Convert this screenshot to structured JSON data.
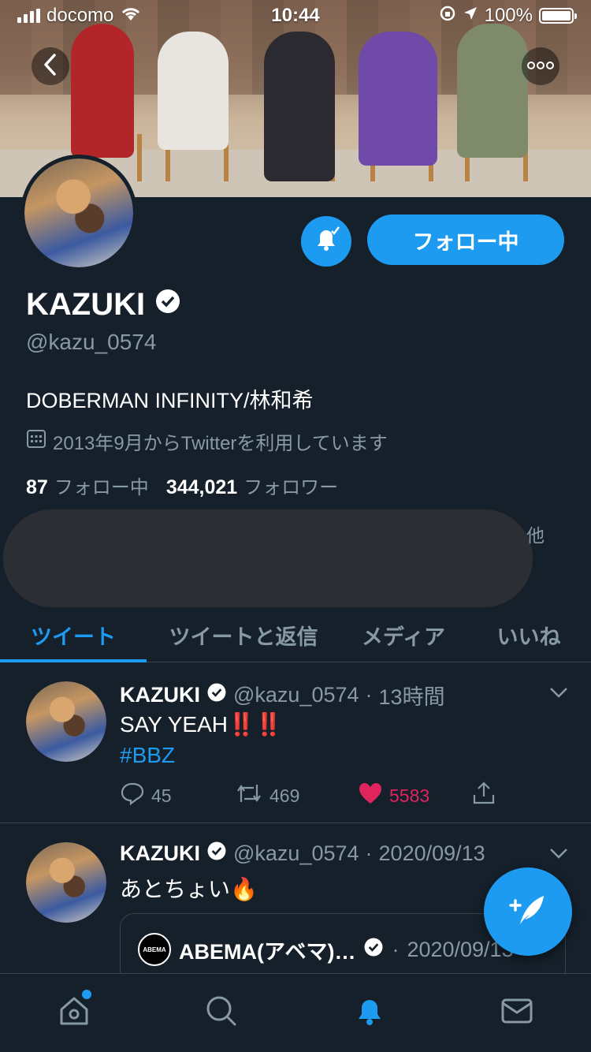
{
  "status_bar": {
    "carrier": "docomo",
    "time": "10:44",
    "battery": "100%"
  },
  "profile": {
    "name": "KAZUKI",
    "handle": "@kazu_0574",
    "bio": "DOBERMAN INFINITY/林和希",
    "joined": "2013年9月からTwitterを利用しています",
    "following_count": "87",
    "following_label": "フォロー中",
    "followers_count": "344,021",
    "followers_label": "フォロワー",
    "follow_button": "フォロー中",
    "followed_by_other": "他"
  },
  "tabs": [
    {
      "label": "ツイート",
      "active": true
    },
    {
      "label": "ツイートと返信",
      "active": false
    },
    {
      "label": "メディア",
      "active": false
    },
    {
      "label": "いいね",
      "active": false
    }
  ],
  "tweets": [
    {
      "name": "KAZUKI",
      "handle": "@kazu_0574",
      "time": "13時間",
      "text": "SAY YEAH‼️‼️",
      "hashtag": "#BBZ",
      "replies": "45",
      "retweets": "469",
      "likes": "5583",
      "liked": true
    },
    {
      "name": "KAZUKI",
      "handle": "@kazu_0574",
      "time": "2020/09/13",
      "text": "あとちょい🔥",
      "quote": {
        "name": "ABEMA(アベマ)…",
        "time": "2020/09/13",
        "avatar_text": "ABEMA"
      }
    }
  ],
  "colors": {
    "background": "#15202b",
    "accent": "#1d9bf0",
    "muted": "#8899a6",
    "like": "#e0245e",
    "divider": "#38444d"
  },
  "icons": {
    "back": "chevron-left-icon",
    "more": "more-icon",
    "bell": "bell-check-icon",
    "verified": "verified-badge-icon",
    "calendar": "calendar-icon",
    "compose": "compose-tweet-icon",
    "nav": [
      "home-icon",
      "search-icon",
      "notifications-icon",
      "messages-icon"
    ]
  }
}
